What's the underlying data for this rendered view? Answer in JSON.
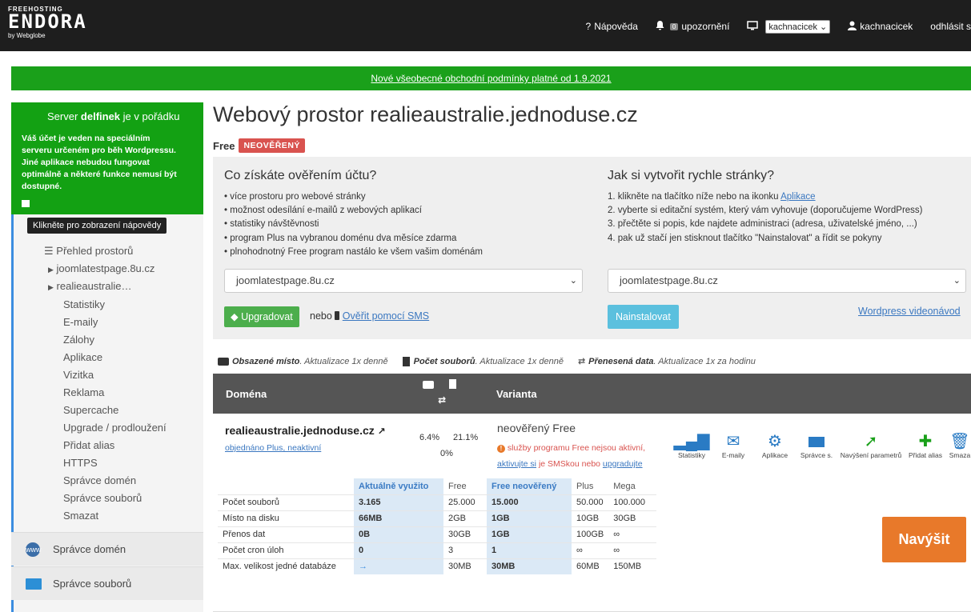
{
  "topbar": {
    "logo_small": "FREEHOSTING",
    "logo_big": "ENDORA",
    "logo_by": "by Webglobe",
    "help": "Nápověda",
    "notif_count": "0",
    "notif_label": "upozornění",
    "account_select": "kachnacicek",
    "user": "kachnacicek",
    "logout": "odhlásit s"
  },
  "banner": {
    "text": "Nové všeobecné obchodní podmínky platné od 1.9.2021"
  },
  "sidebar": {
    "status_prefix": "Server ",
    "status_server": "delfinek",
    "status_suffix": " je v pořádku",
    "note": "Váš účet je veden na speciálním serveru určeném pro běh Wordpressu. Jiné aplikace nebudou fungovat optimálně a některé funkce nemusí být dostupné.",
    "tooltip": "Klikněte pro zobrazení nápovědy",
    "overview": "Přehled prostorů",
    "space1": "joomlatestpage.8u.cz",
    "space2": "realieaustralie…",
    "sub": [
      "Statistiky",
      "E-maily",
      "Zálohy",
      "Aplikace",
      "Vizitka",
      "Reklama",
      "Supercache",
      "Upgrade / prodloužení",
      "Přidat alias",
      "HTTPS",
      "Správce domén",
      "Správce souborů",
      "Smazat"
    ],
    "domains": "Správce domén",
    "files": "Správce souborů"
  },
  "main": {
    "title": "Webový prostor realieaustralie.jednoduse.cz",
    "plan": "Free",
    "tag": "NEOVĚŘENÝ",
    "left_title": "Co získáte ověřením účtu?",
    "left_bullets": [
      "více prostoru pro webové stránky",
      "možnost odesílání e-mailů z webových aplikací",
      "statistiky návštěvnosti",
      "program Plus na vybranou doménu dva měsíce zdarma",
      "plnohodnotný Free program nastálo ke všem vašim doménám"
    ],
    "left_select": "joomlatestpage.8u.cz",
    "upgrade_btn": "Upgradovat",
    "or": "nebo",
    "sms_link": "Ověřit pomocí SMS",
    "right_title": "Jak si vytvořit rychle stránky?",
    "right_step1_pre": "1. klikněte na tlačítko níže nebo na ikonku ",
    "right_step1_link": "Aplikace",
    "right_steps": [
      "2. vyberte si editační systém, který vám vyhovuje (doporučujeme WordPress)",
      "3. přečtěte si popis, kde najdete administraci (adresa, uživatelské jméno, ...)",
      "4. pak už stačí jen stisknout tlačítko \"Nainstalovat\" a řídit se pokyny"
    ],
    "right_select": "joomlatestpage.8u.cz",
    "install_btn": "Nainstalovat",
    "video_link": "Wordpress videonávod"
  },
  "legend": {
    "space_b": "Obsazené místo",
    "space_i": ". Aktualizace 1x denně",
    "files_b": "Počet souborů",
    "files_i": ". Aktualizace 1x denně",
    "transfer_b": "Přenesená data",
    "transfer_i": ". Aktualizace 1x za hodinu"
  },
  "table_head": {
    "domain": "Doména",
    "variant": "Varianta"
  },
  "row": {
    "domain": "realieaustralie.jednoduse.cz",
    "ordered": "objednáno Plus, neaktivní",
    "pct_space": "6.4%",
    "pct_files": "21.1%",
    "pct_transfer": "0%",
    "variant": "neověřený Free",
    "warn_text": " služby programu Free nejsou aktivní,",
    "warn_link1": "aktivujte si",
    "warn_mid": " je SMSkou nebo ",
    "warn_link2": "upgradujte"
  },
  "actions": [
    {
      "label": "Statistiky",
      "icon": "bar-chart-icon"
    },
    {
      "label": "E-maily",
      "icon": "envelope-icon"
    },
    {
      "label": "Aplikace",
      "icon": "gear-icon"
    },
    {
      "label": "Správce s.",
      "icon": "folder-icon"
    },
    {
      "label": "Navýšení parametrů",
      "icon": "rocket-icon"
    },
    {
      "label": "Přidat alias",
      "icon": "plus-icon"
    },
    {
      "label": "Smaza",
      "icon": "trash-icon"
    }
  ],
  "stats": {
    "headers": [
      "",
      "Aktuálně využito",
      "Free",
      "Free neověřený",
      "Plus",
      "Mega"
    ],
    "rows": [
      [
        "Počet souborů",
        "3.165",
        "25.000",
        "15.000",
        "50.000",
        "100.000"
      ],
      [
        "Místo na disku",
        "66MB",
        "2GB",
        "1GB",
        "10GB",
        "30GB"
      ],
      [
        "Přenos dat",
        "0B",
        "30GB",
        "1GB",
        "100GB",
        "∞"
      ],
      [
        "Počet cron úloh",
        "0",
        "3",
        "1",
        "∞",
        "∞"
      ],
      [
        "Max. velikost jedné databáze",
        "→",
        "30MB",
        "30MB",
        "60MB",
        "150MB"
      ]
    ]
  },
  "boost_btn": "Navýšit",
  "colors": {
    "green": "#13a113",
    "blue_accent": "#3b8de0",
    "orange": "#e8792a",
    "danger": "#d9534f"
  }
}
